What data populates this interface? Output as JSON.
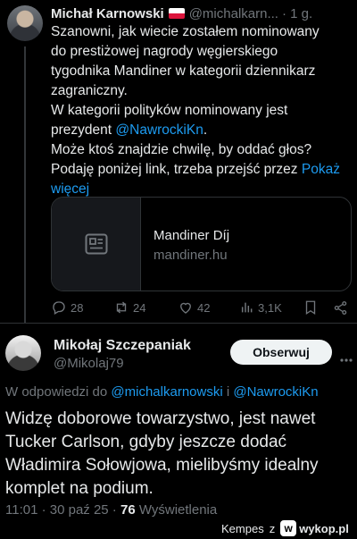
{
  "tweet": {
    "author_name": "Michał Karnowski",
    "author_handle": "@michalkarn...",
    "time": "· 1 g.",
    "body": {
      "line1": "Szanowni, jak wiecie zostałem nominowany",
      "line2": "do prestiżowej nagrody węgierskiego",
      "line3": "tygodnika Mandiner w kategorii dziennikarz",
      "line4": "zagraniczny.",
      "line5": "W kategorii polityków nominowany jest",
      "line6_pre": "prezydent ",
      "line6_mention": "@NawrockiKn",
      "line6_post": ".",
      "line7": "Może ktoś znajdzie chwilę, by oddać głos?",
      "line8": "Podaję poniżej link, trzeba przejść przez ",
      "show_more_a": "Pokaż",
      "show_more_b": "więcej"
    },
    "card": {
      "title": "Mandiner Díj",
      "domain": "mandiner.hu"
    },
    "actions": {
      "replies": "28",
      "reposts": "24",
      "likes": "42",
      "views": "3,1K"
    }
  },
  "reply": {
    "author_name": "Mikołaj Szczepaniak",
    "author_handle": "@Mikolaj79",
    "follow_label": "Obserwuj",
    "replying_prefix": "W odpowiedzi do ",
    "replying_user1": "@michalkarnowski",
    "replying_join": " i ",
    "replying_user2": "@NawrockiKn",
    "body": {
      "line1": "Widzę doborowe towarzystwo, jest nawet",
      "line2": "Tucker Carlson, gdyby jeszcze dodać",
      "line3": "Władimira Sołowjowa, mielibyśmy idealny",
      "line4": "komplet na podium."
    },
    "timestamp": "11:01 · 30 paź 25 · ",
    "views_count": "76",
    "views_label": " Wyświetlenia"
  },
  "watermark": {
    "user": "Kempes",
    "sep": "z",
    "logo_letter": "w",
    "site": "wykop.pl"
  },
  "colors": {
    "background": "#000000",
    "text": "#e7e9ea",
    "secondary": "#71767b",
    "link": "#1d9bf0",
    "flag_white": "#ffffff",
    "flag_red": "#dc143c"
  }
}
